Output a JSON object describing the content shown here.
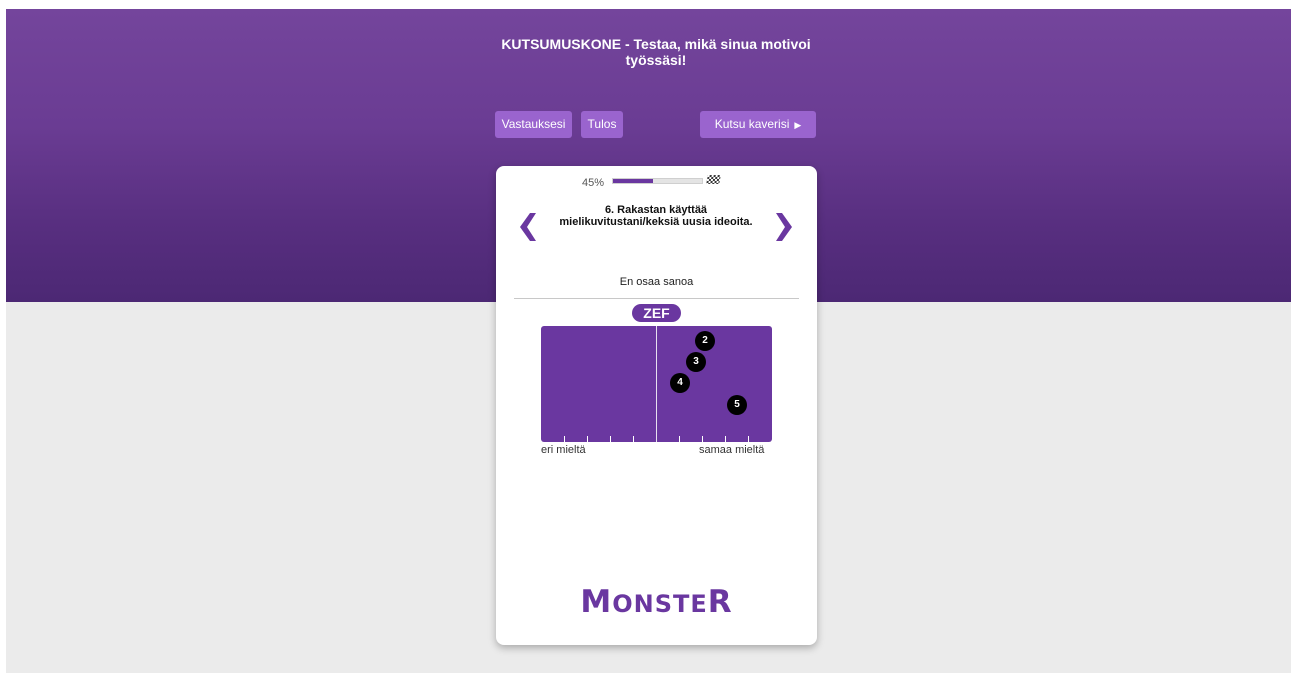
{
  "header": {
    "title": "KUTSUMUSKONE - Testaa, mikä sinua motivoi työssäsi!",
    "nav": {
      "answers_label": "Vastauksesi",
      "result_label": "Tulos",
      "invite_label": "Kutsu kaverisi"
    }
  },
  "card": {
    "progress": {
      "label": "45%",
      "value": 0.45
    },
    "question": "6. Rakastan käyttää mielikuvitustani/keksiä uusia ideoita.",
    "answer": "En osaa sanoa",
    "badge": "ZEF",
    "scale": {
      "left_label": "eri mieltä",
      "right_label": "samaa mieltä",
      "positions": [
        "2",
        "3",
        "4",
        "5"
      ]
    },
    "logo": "MONSTER"
  },
  "colors": {
    "brand_purple": "#6a37a0",
    "button_purple": "#9a64ce",
    "background_gray": "#ebebeb"
  },
  "icons": [
    "arrow-left-icon",
    "arrow-right-icon",
    "play-triangle-icon",
    "checkered-flag-icon"
  ]
}
